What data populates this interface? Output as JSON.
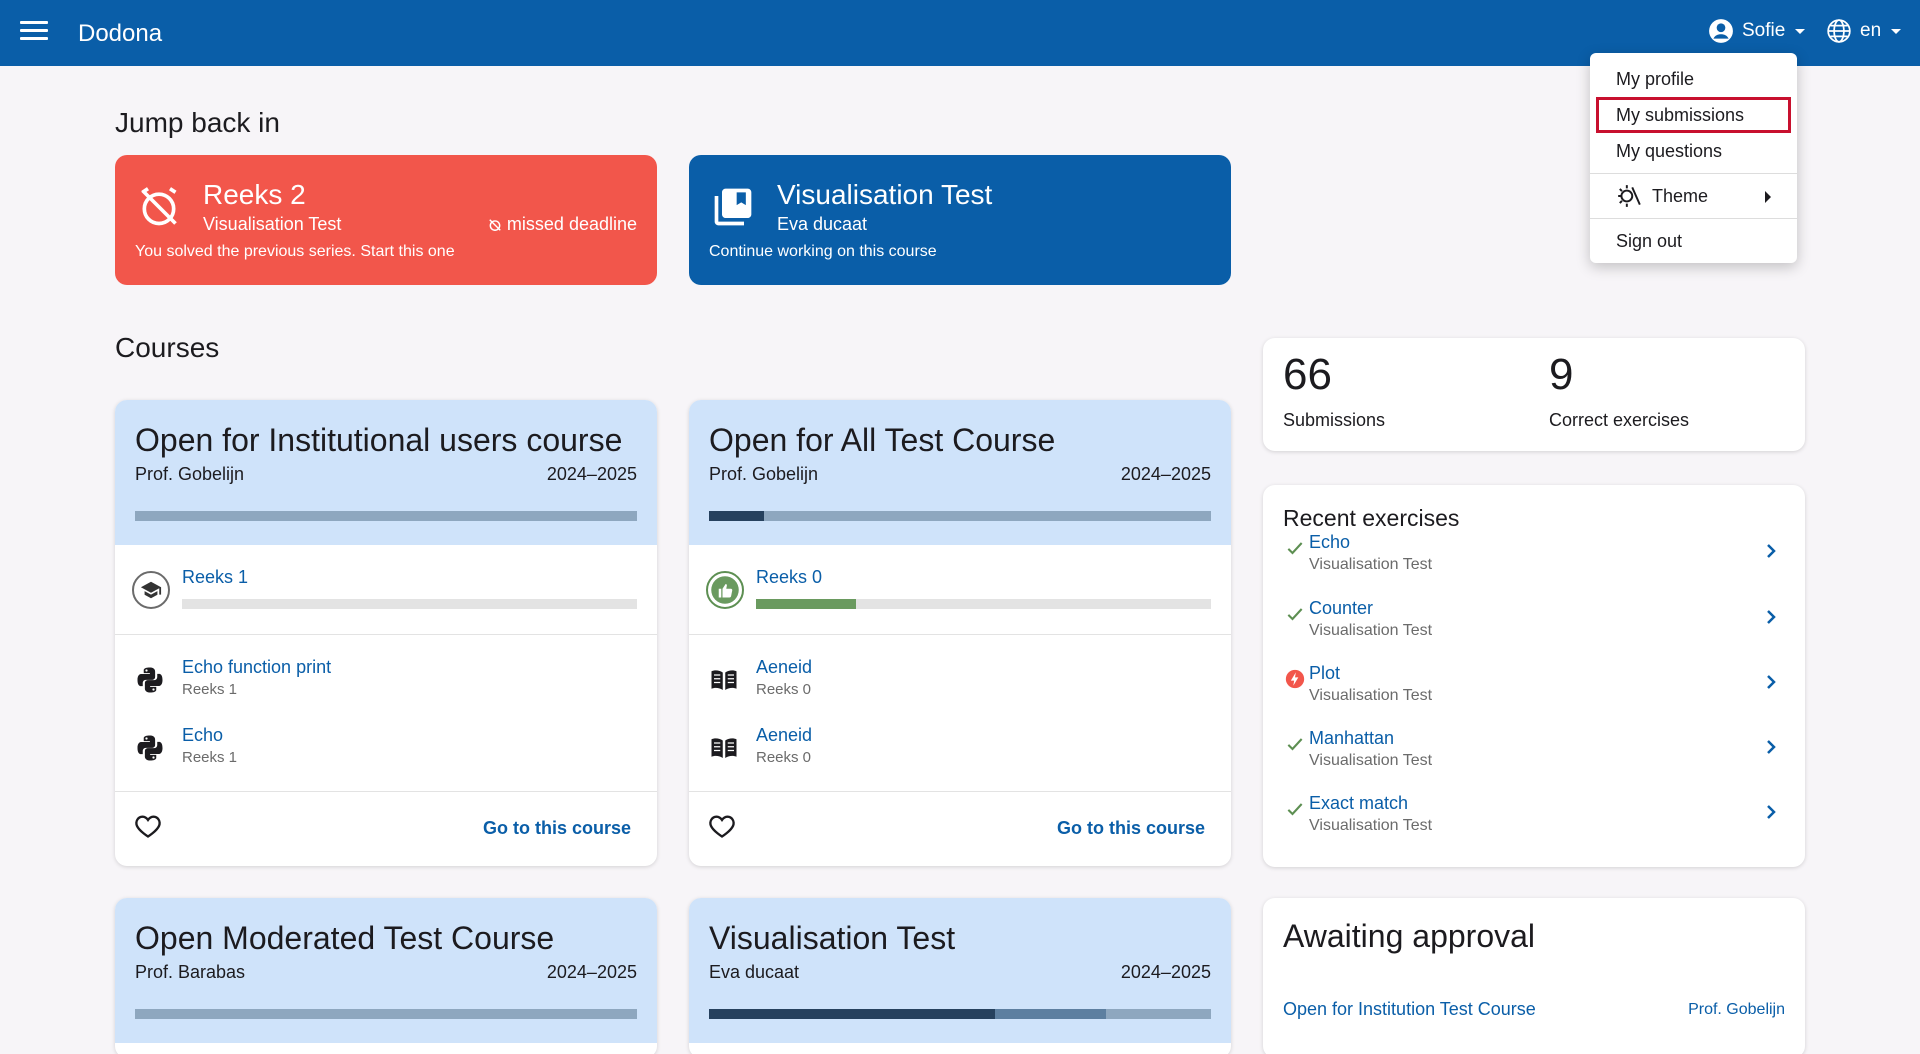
{
  "app": {
    "title": "Dodona"
  },
  "user": {
    "name": "Sofie",
    "lang": "en"
  },
  "user_menu": {
    "profile": "My profile",
    "submissions": "My submissions",
    "questions": "My questions",
    "theme": "Theme",
    "signout": "Sign out"
  },
  "jump": {
    "heading": "Jump back in",
    "cards": [
      {
        "title": "Reeks 2",
        "subtitle": "Visualisation Test",
        "badge": "missed deadline",
        "footer": "You solved the previous series. Start this one"
      },
      {
        "title": "Visualisation Test",
        "subtitle": "Eva ducaat",
        "footer": "Continue working on this course"
      }
    ]
  },
  "courses_heading": "Courses",
  "courses": [
    {
      "title": "Open for Institutional users course",
      "prof": "Prof. Gobelijn",
      "year": "2024–2025",
      "progress": [
        0,
        0
      ],
      "series": {
        "name": "Reeks 1",
        "progress": 0
      },
      "exercises": [
        {
          "name": "Echo function print",
          "series": "Reeks 1",
          "icon": "python-icon"
        },
        {
          "name": "Echo",
          "series": "Reeks 1",
          "icon": "python-icon"
        }
      ],
      "go": "Go to this course"
    },
    {
      "title": "Open for All Test Course",
      "prof": "Prof. Gobelijn",
      "year": "2024–2025",
      "progress": [
        0.11,
        0
      ],
      "series": {
        "name": "Reeks 0",
        "progress": 0.22
      },
      "exercises": [
        {
          "name": "Aeneid",
          "series": "Reeks 0",
          "icon": "book-icon"
        },
        {
          "name": "Aeneid",
          "series": "Reeks 0",
          "icon": "book-icon"
        }
      ],
      "go": "Go to this course"
    },
    {
      "title": "Open Moderated Test Course",
      "prof": "Prof. Barabas",
      "year": "2024–2025",
      "progress": [
        0,
        0
      ]
    },
    {
      "title": "Visualisation Test",
      "prof": "Eva ducaat",
      "year": "2024–2025",
      "progress": [
        0.57,
        0.22
      ]
    }
  ],
  "stats": {
    "submissions": "66",
    "submissions_label": "Submissions",
    "correct": "9",
    "correct_label": "Correct exercises"
  },
  "recent": {
    "title": "Recent exercises",
    "items": [
      {
        "name": "Echo",
        "course": "Visualisation Test",
        "status": "correct"
      },
      {
        "name": "Counter",
        "course": "Visualisation Test",
        "status": "correct"
      },
      {
        "name": "Plot",
        "course": "Visualisation Test",
        "status": "error"
      },
      {
        "name": "Manhattan",
        "course": "Visualisation Test",
        "status": "correct"
      },
      {
        "name": "Exact match",
        "course": "Visualisation Test",
        "status": "correct"
      }
    ]
  },
  "awaiting": {
    "title": "Awaiting approval",
    "course": "Open for Institution Test Course",
    "prof": "Prof. Gobelijn"
  }
}
